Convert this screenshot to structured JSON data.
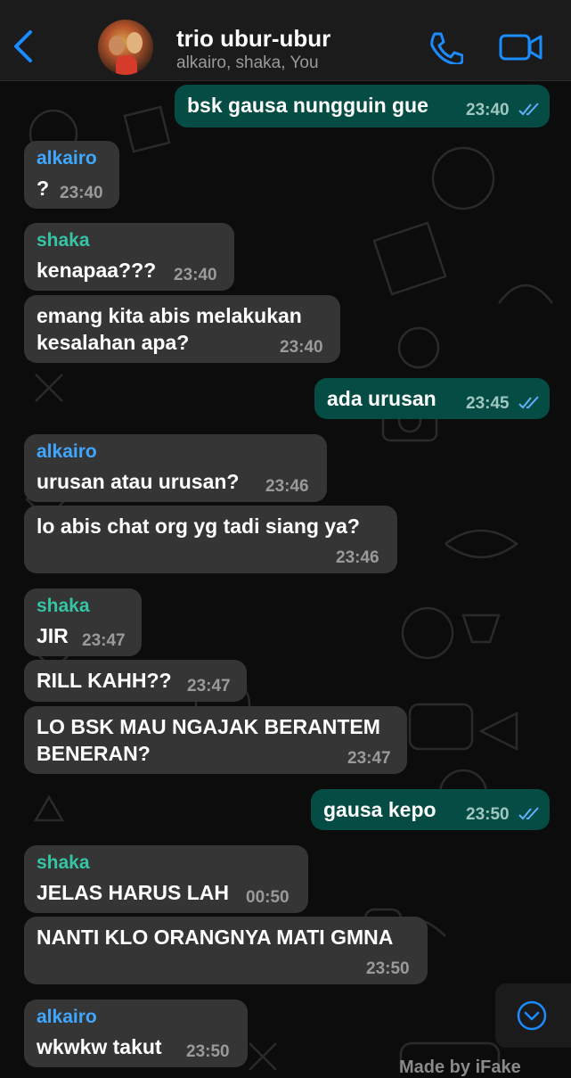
{
  "header": {
    "title": "trio ubur-ubur",
    "subtitle": "alkairo, shaka, You"
  },
  "messages": [
    {
      "dir": "out",
      "text": "bsk gausa nungguin gue",
      "time": "23:40",
      "read": true
    },
    {
      "dir": "in",
      "sender": "alkairo",
      "text": "?",
      "time": "23:40"
    },
    {
      "dir": "in",
      "sender": "shaka",
      "text": "kenapaa???",
      "time": "23:40"
    },
    {
      "dir": "in",
      "text_lines": [
        "emang kita abis melakukan",
        "kesalahan apa?"
      ],
      "time": "23:40"
    },
    {
      "dir": "out",
      "text": "ada urusan",
      "time": "23:45",
      "read": true
    },
    {
      "dir": "in",
      "sender": "alkairo",
      "text": "urusan atau urusan?",
      "time": "23:46"
    },
    {
      "dir": "in",
      "text": "lo abis chat org yg tadi siang ya?",
      "time": "23:46"
    },
    {
      "dir": "in",
      "sender": "shaka",
      "text": "JIR",
      "time": "23:47"
    },
    {
      "dir": "in",
      "text": "RILL KAHH??",
      "time": "23:47"
    },
    {
      "dir": "in",
      "text_lines": [
        "LO BSK MAU NGAJAK BERANTEM",
        "BENERAN?"
      ],
      "time": "23:47"
    },
    {
      "dir": "out",
      "text": "gausa kepo",
      "time": "23:50",
      "read": true
    },
    {
      "dir": "in",
      "sender": "shaka",
      "text": "JELAS HARUS LAH",
      "time": "00:50"
    },
    {
      "dir": "in",
      "text": "NANTI KLO ORANGNYA MATI GMNA",
      "time": "23:50"
    },
    {
      "dir": "in",
      "sender": "alkairo",
      "text": "wkwkw takut",
      "time": "23:50"
    }
  ],
  "watermark": "Made by iFake",
  "colors": {
    "outgoing_bubble": "#054d44",
    "incoming_bubble": "#353535",
    "accent": "#1a8cff",
    "sender_alkairo": "#3fa7ff",
    "sender_shaka": "#36c4a4"
  },
  "icons": {
    "back": "chevron-left-icon",
    "call": "phone-icon",
    "video": "video-camera-icon",
    "read_receipt": "double-check-icon",
    "scroll": "chevron-down-circle-icon"
  }
}
